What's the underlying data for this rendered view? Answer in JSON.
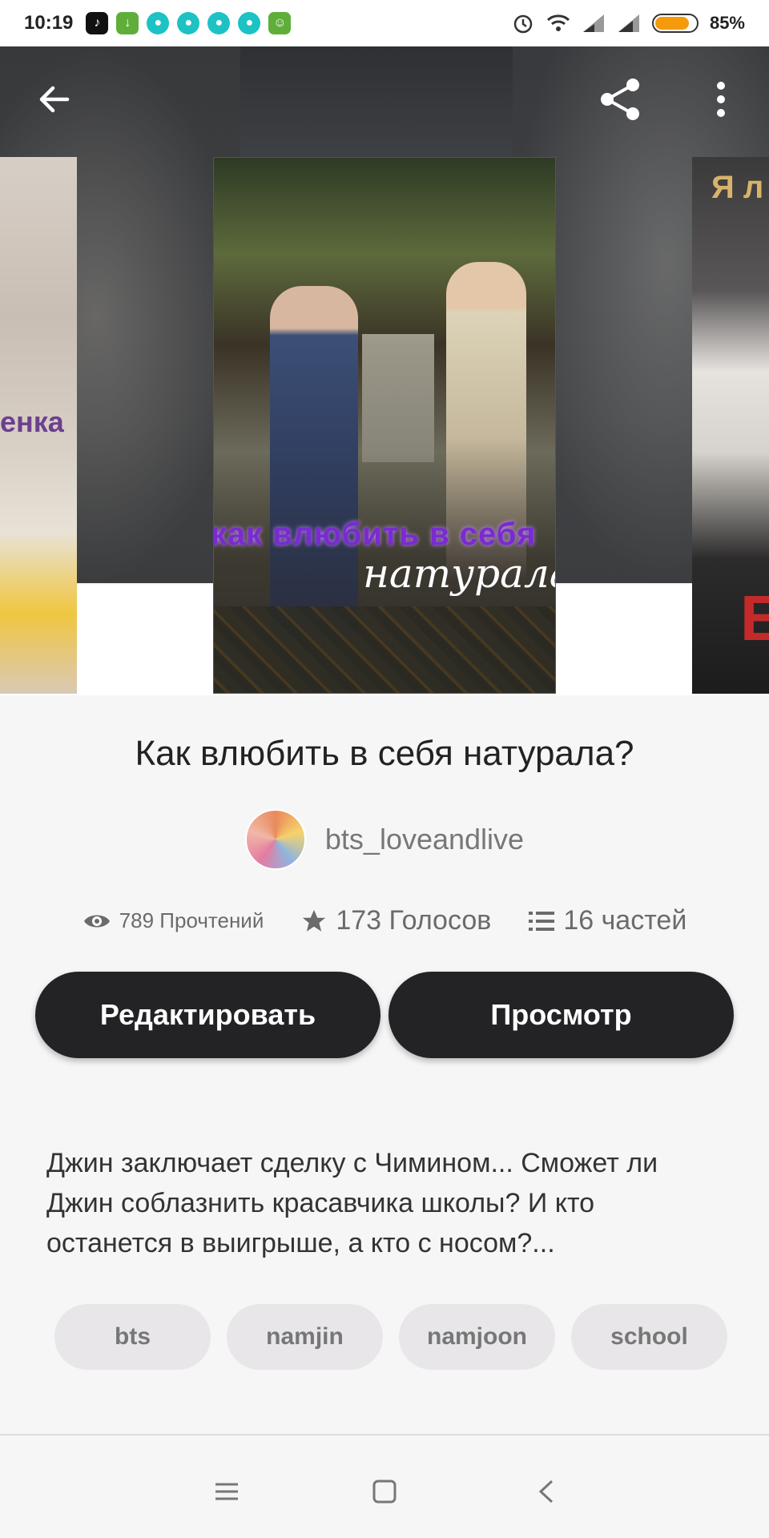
{
  "status_bar": {
    "time": "10:19",
    "battery_percent_label": "85%",
    "battery_level": 0.85,
    "apps": [
      "tiktok-icon",
      "download-icon",
      "teal-app-icon",
      "teal-app-icon",
      "teal-app-icon",
      "teal-app-icon",
      "android-icon"
    ],
    "right_icons": [
      "alarm-icon",
      "wifi-icon",
      "signal-icon",
      "signal-icon",
      "battery-icon"
    ]
  },
  "toolbar": {
    "back_icon": "arrow-left-icon",
    "share_icon": "share-icon",
    "more_icon": "more-vertical-icon"
  },
  "covers": {
    "left_text": "енка",
    "right_text": "Я л",
    "right_letter": "E",
    "main_line1": "как влюбить в себя",
    "main_line2": "натурала"
  },
  "story": {
    "title": "Как влюбить в себя натурала?",
    "author": "bts_loveandlive",
    "stats": {
      "reads": "789 Прочтений",
      "votes": "173 Голосов",
      "parts": "16 частей"
    },
    "buttons": {
      "edit": "Редактировать",
      "preview": "Просмотр"
    },
    "description": "Джин заключает сделку с Чимином... Сможет ли Джин соблазнить красавчика школы? И кто останется в выигрыше, а кто с носом?...",
    "tags": [
      "bts",
      "namjin",
      "namjoon",
      "school"
    ]
  },
  "colors": {
    "button_bg": "#232225",
    "tag_bg": "#e8e6e9",
    "battery": "#f59a0b"
  }
}
